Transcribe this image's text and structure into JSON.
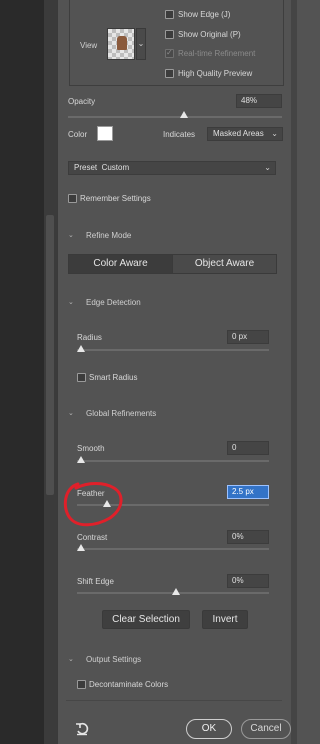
{
  "view": {
    "label": "View",
    "options": {
      "show_edge": "Show Edge (J)",
      "show_original": "Show Original (P)",
      "realtime_refinement": "Real-time Refinement",
      "high_quality_preview": "High Quality Preview"
    }
  },
  "opacity": {
    "label": "Opacity",
    "value": "48%",
    "fraction": 0.48
  },
  "color": {
    "label": "Color",
    "swatch": "#ffffff",
    "indicates_label": "Indicates",
    "indicates_value": "Masked Areas"
  },
  "preset": {
    "label": "Preset",
    "value": "Custom"
  },
  "remember_settings": "Remember Settings",
  "refine_mode": {
    "title": "Refine Mode",
    "color_aware": "Color Aware",
    "object_aware": "Object Aware"
  },
  "edge_detection": {
    "title": "Edge Detection",
    "radius_label": "Radius",
    "radius_value": "0 px",
    "smart_radius": "Smart Radius"
  },
  "global_refinements": {
    "title": "Global Refinements",
    "smooth_label": "Smooth",
    "smooth_value": "0",
    "feather_label": "Feather",
    "feather_value": "2.5 px",
    "contrast_label": "Contrast",
    "contrast_value": "0%",
    "shift_edge_label": "Shift Edge",
    "shift_edge_value": "0%"
  },
  "actions": {
    "clear_selection": "Clear Selection",
    "invert": "Invert"
  },
  "output_settings": {
    "title": "Output Settings",
    "decontaminate_colors": "Decontaminate Colors"
  },
  "footer": {
    "ok": "OK",
    "cancel": "Cancel",
    "reset_icon": "reset-icon"
  },
  "colors": {
    "panel_bg": "#535353",
    "highlight_blue": "#3373c7",
    "annotation_red": "#e0202a"
  }
}
